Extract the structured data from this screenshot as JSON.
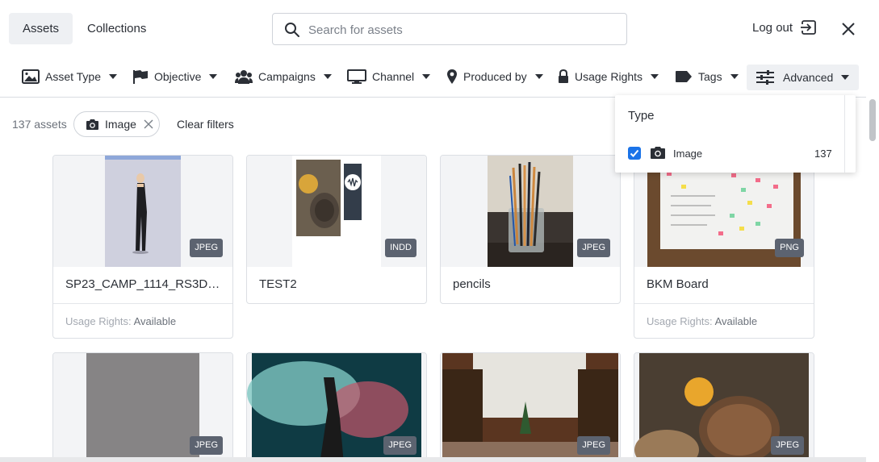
{
  "tabs": [
    {
      "label": "Assets",
      "active": true
    },
    {
      "label": "Collections",
      "active": false
    }
  ],
  "search": {
    "placeholder": "Search for assets",
    "value": ""
  },
  "header": {
    "logout_label": "Log out"
  },
  "filters": [
    {
      "label": "Asset Type",
      "icon": "image-icon"
    },
    {
      "label": "Objective",
      "icon": "flag-icon"
    },
    {
      "label": "Campaigns",
      "icon": "users-icon"
    },
    {
      "label": "Channel",
      "icon": "monitor-icon"
    },
    {
      "label": "Produced by",
      "icon": "location-pin-icon"
    },
    {
      "label": "Usage Rights",
      "icon": "lock-icon"
    },
    {
      "label": "Tags",
      "icon": "tag-icon"
    },
    {
      "label": "Advanced",
      "icon": "sliders-icon",
      "active": true
    }
  ],
  "results": {
    "count_label": "137 assets",
    "active_filter_chip": "Image",
    "clear_label": "Clear filters"
  },
  "dropdown": {
    "title": "Type",
    "option_label": "Image",
    "option_count": "137",
    "option_checked": true
  },
  "colors": {
    "accent": "#1b73e8",
    "badge": "#5c6370",
    "tab_active_bg": "#eef0f3"
  },
  "assets": [
    {
      "name": "SP23_CAMP_1114_RS3D0...",
      "type": "JPEG",
      "rights_label": "Usage Rights:",
      "rights_value": "Available"
    },
    {
      "name": "TEST2",
      "type": "INDD"
    },
    {
      "name": "pencils",
      "type": "JPEG"
    },
    {
      "name": "BKM Board",
      "type": "PNG",
      "rights_label": "Usage Rights:",
      "rights_value": "Available"
    },
    {
      "name": "",
      "type": "JPEG"
    },
    {
      "name": "",
      "type": "JPEG"
    },
    {
      "name": "",
      "type": "JPEG"
    },
    {
      "name": "",
      "type": "JPEG"
    }
  ]
}
